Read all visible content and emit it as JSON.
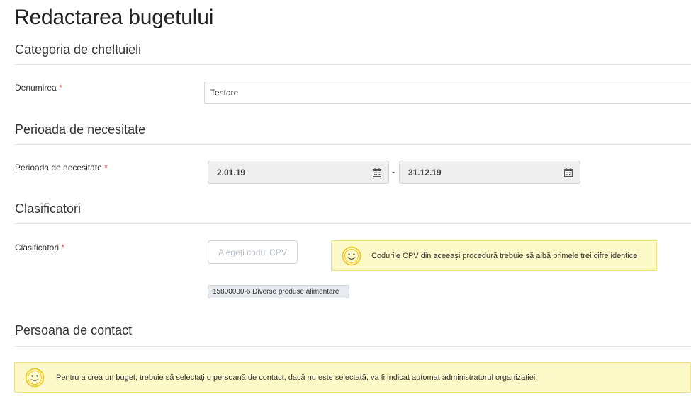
{
  "page": {
    "title": "Redactarea bugetului"
  },
  "sections": {
    "category": {
      "title": "Categoria de cheltuieli",
      "name_label": "Denumirea",
      "name_value": "Testare",
      "required_mark": "*"
    },
    "period": {
      "title": "Perioada de necesitate",
      "label": "Perioada de necesitate",
      "required_mark": "*",
      "start": "2.01.19",
      "separator": "-",
      "end": "31.12.19"
    },
    "classifiers": {
      "title": "Clasificatori",
      "label": "Clasificatori",
      "required_mark": "*",
      "choose_button": "Alegeți codul CPV",
      "hint": "Codurile CPV din aceeași procedură trebuie să aibă primele trei cifre identice",
      "selected_tag": "15800000-6 Diverse produse alimentare"
    },
    "contact": {
      "title": "Persoana de contact",
      "hint": "Pentru a crea un buget, trebuie să selectați o persoană de contact, dacă nu este selectată, va fi indicat automat administratorul organizației."
    }
  },
  "colors": {
    "required": "#d9534f",
    "note_bg": "#fdf9c8",
    "note_border": "#eedf86",
    "smiley": "#f0c419"
  },
  "icons": [
    "calendar-icon",
    "smiley-icon"
  ]
}
